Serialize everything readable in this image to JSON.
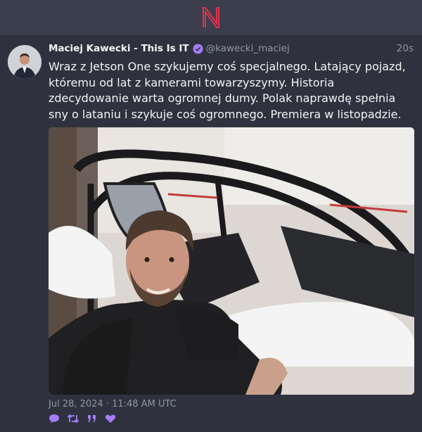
{
  "app": {
    "logo_letter": "N",
    "accent": "#e0344e"
  },
  "tweet": {
    "author_name": "Maciej Kawecki - This Is IT",
    "verified": true,
    "handle": "@kawecki_maciej",
    "relative_time": "20s",
    "text": "Wraz z Jetson One szykujemy coś specjalnego. Latający pojazd, któremu od lat z kamerami towarzyszymy. Historia zdecydowanie warta ogromnej dumy. Polak naprawdę spełnia sny o lataniu i szykuje coś ogromnego. Premiera w listopadzie.",
    "date": "Jul 28, 2024 · 11:48 AM UTC",
    "actions": [
      {
        "name": "reply-icon",
        "glyph": "💬"
      },
      {
        "name": "retweet-icon",
        "glyph": "⇄"
      },
      {
        "name": "quote-icon",
        "glyph": "❞"
      },
      {
        "name": "like-icon",
        "glyph": "♥"
      }
    ]
  },
  "colors": {
    "background": "#2f323e",
    "link": "#a57dff",
    "muted": "#9096a8"
  }
}
